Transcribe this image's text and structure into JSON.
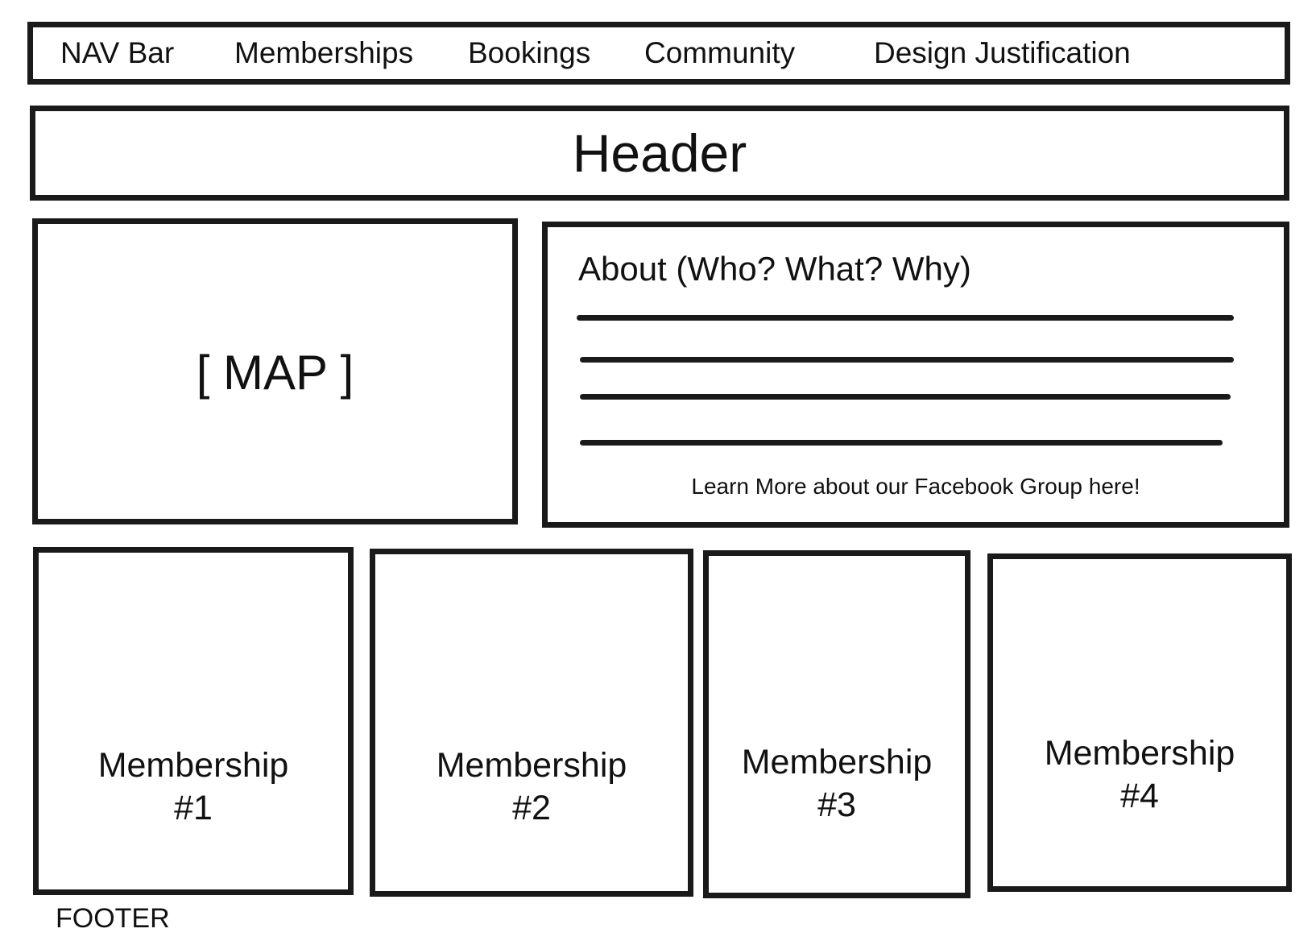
{
  "nav": {
    "items": [
      {
        "label": "NAV Bar"
      },
      {
        "label": "Memberships"
      },
      {
        "label": "Bookings"
      },
      {
        "label": "Community"
      },
      {
        "label": "Design Justification"
      }
    ]
  },
  "header": {
    "title": "Header"
  },
  "map": {
    "label": "[ MAP ]"
  },
  "about": {
    "title": "About (Who? What? Why)",
    "link_text": "Learn More about our Facebook Group here!"
  },
  "memberships": [
    {
      "line1": "Membership",
      "line2": "#1"
    },
    {
      "line1": "Membership",
      "line2": "#2"
    },
    {
      "line1": "Membership",
      "line2": "#3"
    },
    {
      "line1": "Membership",
      "line2": "#4"
    }
  ],
  "footer": {
    "label": "FOOTER"
  },
  "colors": {
    "stroke": "#1a1a1a",
    "background": "#ffffff",
    "text": "#111111"
  }
}
